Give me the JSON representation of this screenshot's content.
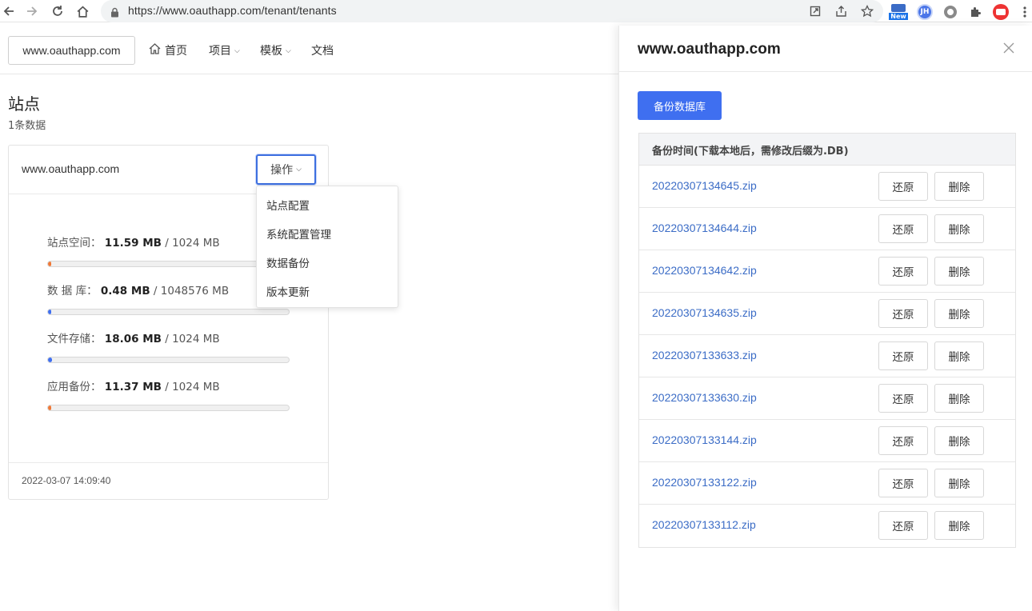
{
  "browser": {
    "url": "https://www.oauthapp.com/tenant/tenants",
    "ext_new_badge": "New",
    "ext_jh_label": "JH"
  },
  "header": {
    "tenant_select": "www.oauthapp.com",
    "nav": [
      "首页",
      "项目",
      "模板",
      "文档"
    ]
  },
  "page": {
    "title": "站点",
    "count": "1条数据"
  },
  "card": {
    "site": "www.oauthapp.com",
    "op_button": "操作",
    "stats": [
      {
        "label": "站点空间：",
        "used": "11.59 MB",
        "total": "/ 1024 MB",
        "fraction": 0.0113,
        "color": "#f07836"
      },
      {
        "label": "数 据 库：",
        "used": "0.48 MB",
        "total": "/ 1048576 MB",
        "fraction": 0.0,
        "color": "#3f6ff0"
      },
      {
        "label": "文件存储：",
        "used": "18.06 MB",
        "total": "/ 1024 MB",
        "fraction": 0.0176,
        "color": "#3f6ff0"
      },
      {
        "label": "应用备份：",
        "used": "11.37 MB",
        "total": "/ 1024 MB",
        "fraction": 0.0111,
        "color": "#f07836"
      }
    ],
    "created": "2022-03-07 14:09:40"
  },
  "dropdown": {
    "items": [
      "站点配置",
      "系统配置管理",
      "数据备份",
      "版本更新"
    ]
  },
  "drawer": {
    "title": "www.oauthapp.com",
    "backup_button": "备份数据库",
    "table_header": "备份时间(下载本地后，需修改后缀为.DB)",
    "restore_label": "还原",
    "delete_label": "删除",
    "files": [
      "20220307134645.zip",
      "20220307134644.zip",
      "20220307134642.zip",
      "20220307134635.zip",
      "20220307133633.zip",
      "20220307133630.zip",
      "20220307133144.zip",
      "20220307133122.zip",
      "20220307133112.zip"
    ]
  }
}
